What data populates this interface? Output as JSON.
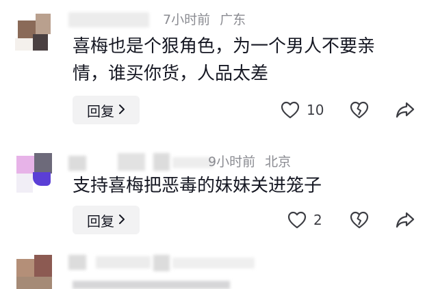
{
  "comments": [
    {
      "time": "7小时前",
      "location": "广东",
      "text_line1": "喜梅也是个狠角色，为一个男人不要亲",
      "text_line2": "情，谁买你货，人品太差",
      "reply_label": "回复",
      "like_count": "10"
    },
    {
      "time": "9小时前",
      "location": "北京",
      "text_line1": "支持喜梅把恶毒的妹妹关进笼子",
      "reply_label": "回复",
      "like_count": "2"
    },
    {
      "time": "",
      "location": "",
      "text_line1": "",
      "reply_label": ""
    }
  ],
  "icons": {
    "like": "heart-outline-icon",
    "dislike": "broken-heart-icon",
    "share": "share-arrow-icon",
    "reply_chevron": "chevron-right-icon"
  },
  "colors": {
    "text": "#161823",
    "meta": "#8a8b91",
    "reply_bg": "#f2f2f3"
  }
}
